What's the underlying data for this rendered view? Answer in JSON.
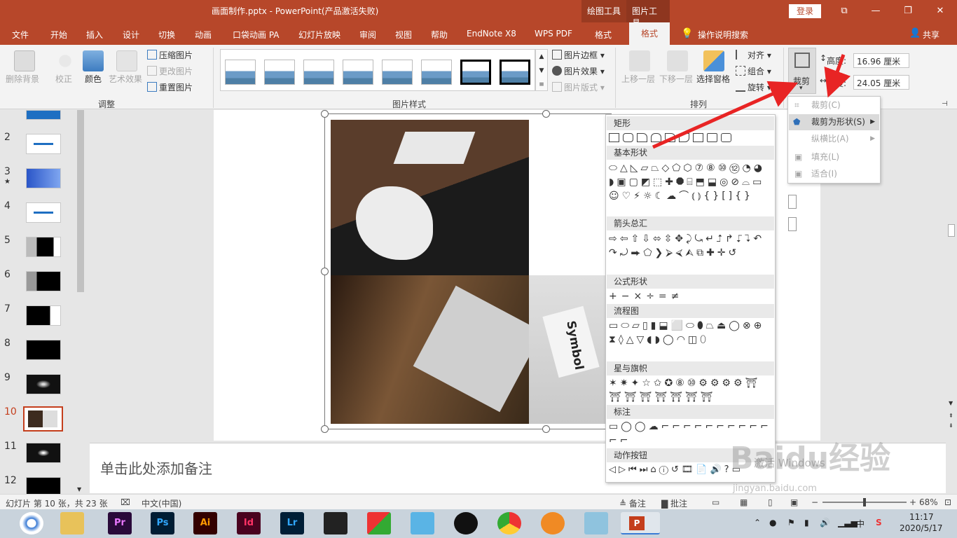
{
  "window": {
    "title": "画面制作.pptx  -  PowerPoint(产品激活失败)",
    "context_tabs": [
      "绘图工具",
      "图片工具"
    ],
    "login": "登录",
    "controls": [
      "—",
      "❐",
      "✕"
    ],
    "restore_icon": "⧉"
  },
  "tabs": [
    "文件",
    "开始",
    "插入",
    "设计",
    "切换",
    "动画",
    "口袋动画 PA",
    "幻灯片放映",
    "审阅",
    "视图",
    "帮助",
    "EndNote X8",
    "WPS PDF",
    "格式",
    "格式"
  ],
  "tell_me": "操作说明搜索",
  "share": "共享",
  "ribbon": {
    "adjust": {
      "remove_bg": "删除背景",
      "correct": "校正",
      "color": "颜色",
      "art_effects": "艺术效果",
      "compress": "压缩图片",
      "change": "更改图片",
      "reset": "重置图片",
      "group_label": "调整"
    },
    "styles": {
      "border": "图片边框",
      "effects": "图片效果",
      "layout": "图片版式",
      "group_label": "图片样式"
    },
    "arrange": {
      "bring_forward": "上移一层",
      "send_backward": "下移一层",
      "selection_pane": "选择窗格",
      "align": "对齐",
      "group": "组合",
      "rotate": "旋转",
      "group_label": "排列"
    },
    "size": {
      "crop": "裁剪",
      "height_label": "高度:",
      "height_value": "16.96 厘米",
      "width_label": "宽度:",
      "width_value": "24.05 厘米"
    }
  },
  "crop_menu": [
    {
      "label": "裁剪(C)",
      "enabled": false
    },
    {
      "label": "裁剪为形状(S)",
      "enabled": true
    },
    {
      "label": "纵横比(A)",
      "enabled": false
    },
    {
      "label": "填充(L)",
      "enabled": false
    },
    {
      "label": "适合(I)",
      "enabled": false
    }
  ],
  "shape_gallery": {
    "sections": [
      "矩形",
      "基本形状",
      "箭头总汇",
      "公式形状",
      "流程图",
      "星与旗帜",
      "标注",
      "动作按钮"
    ],
    "glyphs": {
      "basic": "⬭△◺▱⏢◇⬠⬡⑦⑧⑩⑫◔◕◗▣▢◩⬚✚⯃⌸⬒⬓◎⊘⌓▭☺♡⚡☼☾☁⌒⦅⦆{}[]{}",
      "arrows": "⇨⇦⇧⇩⬄⇳✥⤸⤿↵⮥↱⮦⮧↶↷⤾⮕⬠❯⮚⮘⮙⧉✚✛↺",
      "formula": "+−×÷=≠",
      "flowchart": "▭⬭▱▯▮⬓⬜⬭⬮⏢⏏◯⊗⊕⧗◊△▽◖◗◯◠◫⬯",
      "stars": "✶✷✦☆✩✪⑧⑩⚙⚙⚙⚙⛩⛩⛩⛩⛩⛩⛩⛩",
      "callouts": "▭◯◯☁⌐⌐⌐⌐⌐⌐⌐⌐⌐⌐⌐⌐",
      "actions": "◁▷⏮⏭⌂ⓘ↺🎞📄🔊?▭"
    }
  },
  "slides": {
    "numbers": [
      "2",
      "3",
      "4",
      "5",
      "6",
      "7",
      "8",
      "9",
      "10",
      "11",
      "12"
    ],
    "star": "★",
    "current": "10"
  },
  "notes_placeholder": "单击此处添加备注",
  "photo_text": "Symbol",
  "status": {
    "slide_info": "幻灯片 第 10 张，共 23 张",
    "language": "中文(中国)",
    "notes": "备注",
    "comments": "批注",
    "zoom": "68%"
  },
  "taskbar": {
    "apps": [
      "Pr",
      "Ps",
      "Ai",
      "Id",
      "Lr"
    ],
    "time": "11:17",
    "date": "2020/5/17",
    "ime": "中"
  },
  "watermark": "Baidu经验",
  "watermark_sub": "jingyan.baidu.com",
  "activate_text": "激活 Windows"
}
